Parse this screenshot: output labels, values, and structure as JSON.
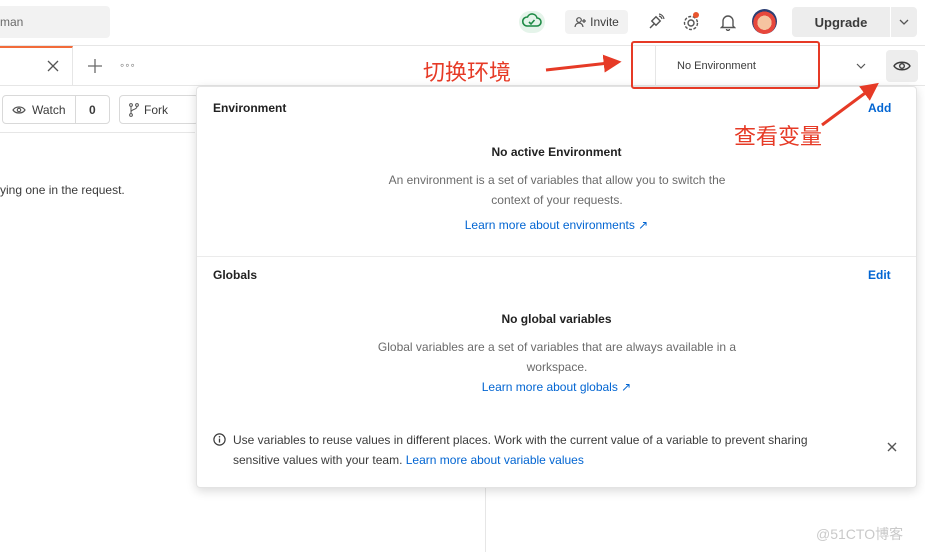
{
  "header": {
    "search_placeholder": "man",
    "invite_label": "Invite",
    "upgrade_label": "Upgrade"
  },
  "environment_selector": {
    "value": "No Environment"
  },
  "left_panel": {
    "watch_label": "Watch",
    "watch_count": "0",
    "fork_label": "Fork",
    "description_text": "ying one in the request."
  },
  "popup": {
    "environment": {
      "title": "Environment",
      "action": "Add",
      "empty_title": "No active Environment",
      "empty_desc_line1": "An environment is a set of variables that allow you to switch the",
      "empty_desc_line2": "context of your requests.",
      "learn_more": "Learn more about environments ↗"
    },
    "globals": {
      "title": "Globals",
      "action": "Edit",
      "empty_title": "No global variables",
      "empty_desc_line1": "Global variables are a set of variables that are always available in a",
      "empty_desc_line2": "workspace.",
      "learn_more": "Learn more about globals ↗"
    },
    "info": {
      "text": "Use variables to reuse values in different places. Work with the current value of a variable to prevent sharing sensitive values with your team.",
      "link": "Learn more about variable values"
    }
  },
  "annotations": {
    "switch_env": "切换环境",
    "view_vars": "查看变量"
  },
  "watermark": "@51CTO博客",
  "colors": {
    "accent": "#f26b3a",
    "link": "#0265d2",
    "annotation": "#e63a26"
  }
}
